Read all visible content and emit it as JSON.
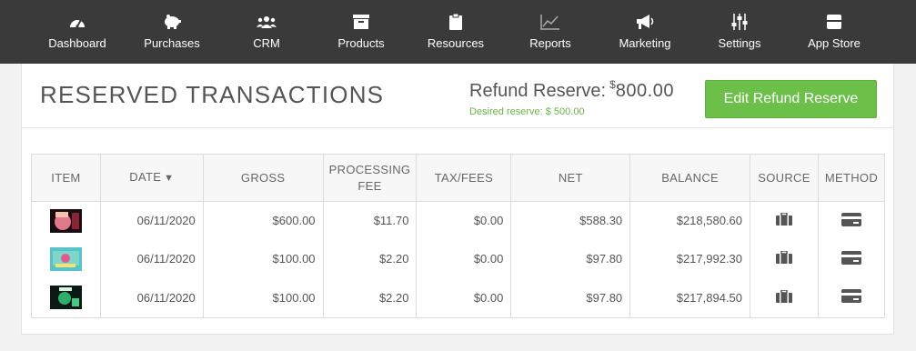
{
  "nav": [
    {
      "label": "Dashboard",
      "icon": "dashboard-gauge-icon"
    },
    {
      "label": "Purchases",
      "icon": "piggy-bank-icon"
    },
    {
      "label": "CRM",
      "icon": "users-icon"
    },
    {
      "label": "Products",
      "icon": "archive-box-icon"
    },
    {
      "label": "Resources",
      "icon": "clipboard-icon"
    },
    {
      "label": "Reports",
      "icon": "line-chart-icon"
    },
    {
      "label": "Marketing",
      "icon": "megaphone-icon"
    },
    {
      "label": "Settings",
      "icon": "sliders-icon"
    },
    {
      "label": "App Store",
      "icon": "store-icon"
    }
  ],
  "header": {
    "title": "RESERVED TRANSACTIONS",
    "reserve_label": "Refund Reserve:",
    "reserve_currency": "$",
    "reserve_amount": "800.00",
    "desired": "Desired reserve: $ 500.00",
    "edit_button": "Edit Refund Reserve"
  },
  "table": {
    "columns": {
      "item": "ITEM",
      "date": "DATE",
      "date_sort": "▼",
      "gross": "GROSS",
      "processing_1": "PROCESSING",
      "processing_2": "FEE",
      "tax": "TAX/FEES",
      "net": "NET",
      "balance": "BALANCE",
      "source": "SOURCE",
      "method": "METHOD"
    },
    "rows": [
      {
        "date": "06/11/2020",
        "gross": "$600.00",
        "fee": "$11.70",
        "tax": "$0.00",
        "net": "$588.30",
        "balance": "$218,580.60"
      },
      {
        "date": "06/11/2020",
        "gross": "$100.00",
        "fee": "$2.20",
        "tax": "$0.00",
        "net": "$97.80",
        "balance": "$217,992.30"
      },
      {
        "date": "06/11/2020",
        "gross": "$100.00",
        "fee": "$2.20",
        "tax": "$0.00",
        "net": "$97.80",
        "balance": "$217,894.50"
      }
    ]
  },
  "colors": {
    "nav_bg": "#3a3a3a",
    "accent_green": "#6cc04a",
    "desired_green": "#6bb34a"
  }
}
